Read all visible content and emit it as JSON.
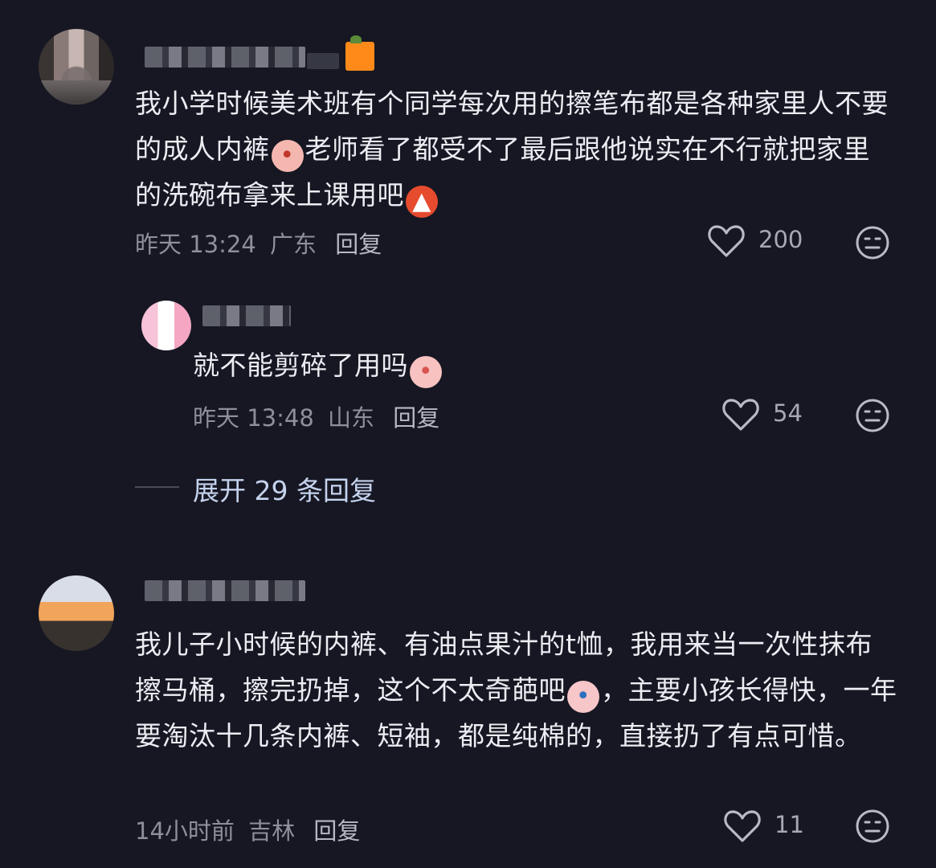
{
  "comments": [
    {
      "text_parts": [
        "我小学时候美术班有个同学每次用的擦笔布都是各种家里人不要的成人内裤",
        "老师看了都受不了最后跟他说实在不行就把家里的洗碗布拿来上课用吧"
      ],
      "time": "昨天 13:24",
      "location": "广东",
      "reply_label": "回复",
      "likes": "200"
    },
    {
      "text": "就不能剪碎了用吗",
      "time": "昨天 13:48",
      "location": "山东",
      "reply_label": "回复",
      "likes": "54"
    },
    {
      "text_parts": [
        "我儿子小时候的内裤、有油点果汁的t恤，我用来当一次性抹布擦马桶，擦完扔掉，这个不太奇葩吧",
        "，主要小孩长得快，一年要淘汰十几条内裤、短袖，都是纯棉的，直接扔了有点可惜。"
      ],
      "time": "14小时前",
      "location": "吉林",
      "reply_label": "回复",
      "likes": "11"
    }
  ],
  "expand_replies": "展开 29 条回复",
  "icons": {
    "like": "heart-outline-icon",
    "dislike": "meh-face-icon"
  }
}
